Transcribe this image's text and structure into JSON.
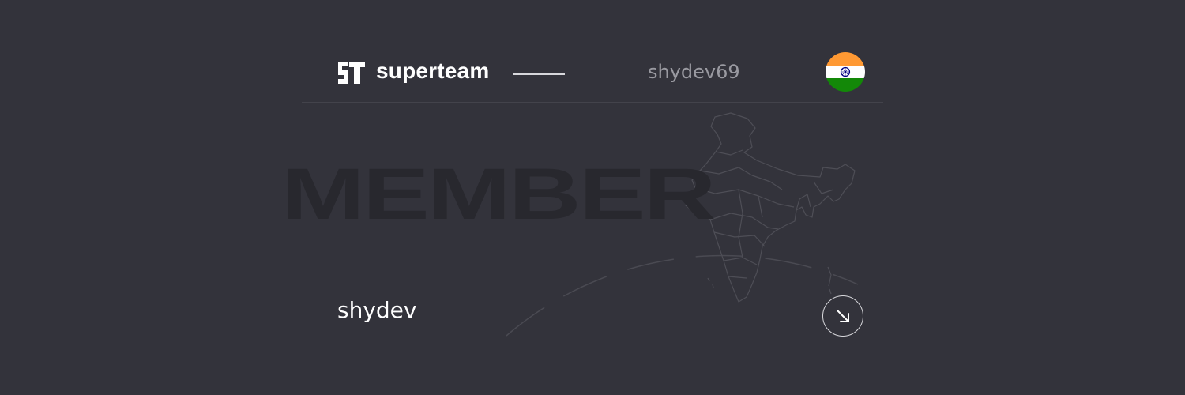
{
  "brand": {
    "name": "superteam",
    "logo_icon": "superteam-st-logo-icon"
  },
  "header": {
    "handle": "shydev69",
    "country_flag_icon": "india-flag-icon"
  },
  "badge": {
    "title": "MEMBER",
    "map_icon": "india-map-icon"
  },
  "member": {
    "name": "shydev",
    "action_icon": "arrow-down-right-icon"
  },
  "colors": {
    "background": "#33333b",
    "text_primary": "#ffffff",
    "text_muted": "#9a9aa1",
    "watermark": "#28282e",
    "flag_saffron": "#ff9933",
    "flag_white": "#ffffff",
    "flag_green": "#138808",
    "flag_chakra": "#000080"
  }
}
